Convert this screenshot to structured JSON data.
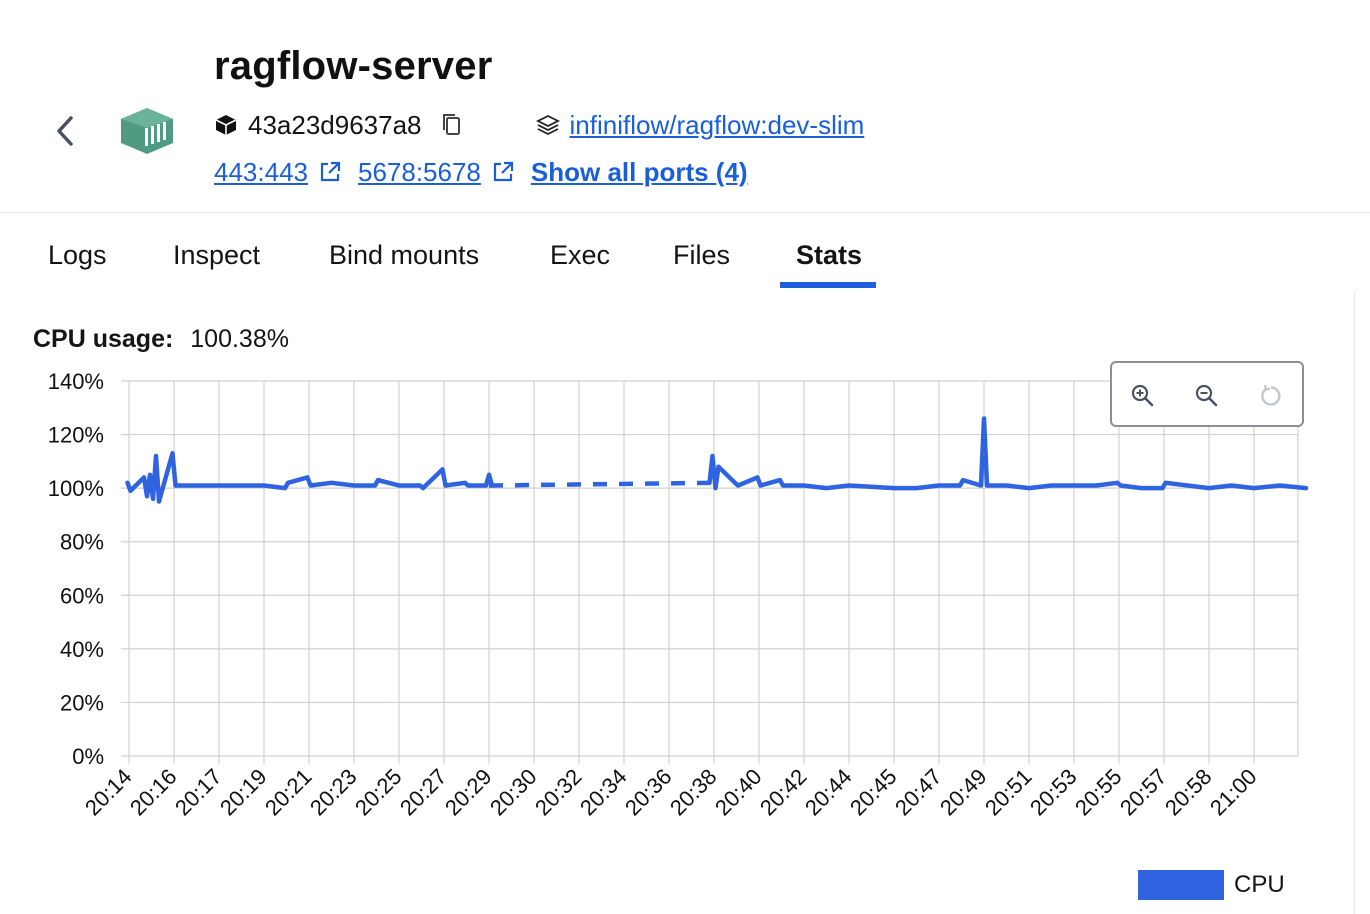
{
  "container": {
    "name": "ragflow-server",
    "id": "43a23d9637a8",
    "image": "infiniflow/ragflow:dev-slim",
    "ports": [
      "443:443",
      "5678:5678"
    ],
    "show_all_ports": "Show all ports (4)"
  },
  "tabs": [
    {
      "label": "Logs"
    },
    {
      "label": "Inspect"
    },
    {
      "label": "Bind mounts"
    },
    {
      "label": "Exec"
    },
    {
      "label": "Files"
    },
    {
      "label": "Stats"
    }
  ],
  "active_tab": "Stats",
  "stats": {
    "cpu_label": "CPU usage:",
    "cpu_value": "100.38%"
  },
  "icons": {
    "back": "chevron-left-icon",
    "container": "container-icon",
    "id": "cube-icon",
    "copy": "copy-icon",
    "image": "image-layers-icon",
    "external": "external-link-icon",
    "zoom_in": "zoom-in-icon",
    "zoom_out": "zoom-out-icon",
    "reset": "reset-icon"
  },
  "colors": {
    "accent": "#1f5fe0",
    "series": "#2f63e0",
    "container_icon": "#4f9a83",
    "link": "#1a5fd8"
  },
  "chart_data": {
    "type": "line",
    "ylim": [
      0,
      140
    ],
    "yticks": [
      "0%",
      "20%",
      "40%",
      "60%",
      "80%",
      "100%",
      "120%",
      "140%"
    ],
    "x_ticks": [
      "20:14",
      "20:16",
      "20:17",
      "20:19",
      "20:21",
      "20:23",
      "20:25",
      "20:27",
      "20:29",
      "20:30",
      "20:32",
      "20:34",
      "20:36",
      "20:38",
      "20:40",
      "20:42",
      "20:44",
      "20:45",
      "20:47",
      "20:49",
      "20:51",
      "20:53",
      "20:55",
      "20:57",
      "20:58",
      "21:00"
    ],
    "grid": true,
    "legend": "bottom-right",
    "series": [
      {
        "name": "CPU",
        "segments": [
          {
            "style": "solid",
            "points": [
              [
                "20:14",
                102
              ],
              [
                "20:14",
                99
              ],
              [
                "20:15",
                104
              ],
              [
                "20:15",
                97
              ],
              [
                "20:15",
                105
              ],
              [
                "20:15",
                96
              ],
              [
                "20:15",
                112
              ],
              [
                "20:15",
                95
              ],
              [
                "20:16",
                113
              ],
              [
                "20:16",
                101
              ],
              [
                "20:17",
                101
              ],
              [
                "20:18",
                101
              ],
              [
                "20:19",
                101
              ],
              [
                "20:20",
                100
              ],
              [
                "20:20",
                102
              ],
              [
                "20:21",
                104
              ],
              [
                "20:21",
                101
              ],
              [
                "20:22",
                102
              ],
              [
                "20:23",
                101
              ],
              [
                "20:24",
                101
              ],
              [
                "20:24",
                103
              ],
              [
                "20:25",
                101
              ],
              [
                "20:26",
                101
              ],
              [
                "20:26",
                100
              ],
              [
                "20:27",
                107
              ],
              [
                "20:27",
                101
              ],
              [
                "20:28",
                102
              ],
              [
                "20:28",
                101
              ],
              [
                "20:29",
                101
              ],
              [
                "20:29",
                105
              ],
              [
                "20:29",
                101
              ]
            ]
          },
          {
            "style": "dashed",
            "points": [
              [
                "20:29",
                101
              ],
              [
                "20:38",
                102
              ]
            ]
          },
          {
            "style": "solid",
            "points": [
              [
                "20:38",
                102
              ],
              [
                "20:38",
                112
              ],
              [
                "20:38",
                100
              ],
              [
                "20:38",
                108
              ],
              [
                "20:39",
                102
              ],
              [
                "20:39",
                101
              ],
              [
                "20:40",
                104
              ],
              [
                "20:40",
                101
              ],
              [
                "20:41",
                103
              ],
              [
                "20:41",
                101
              ],
              [
                "20:42",
                101
              ],
              [
                "20:43",
                100
              ],
              [
                "20:44",
                101
              ],
              [
                "20:45",
                100
              ],
              [
                "20:46",
                100
              ],
              [
                "20:47",
                101
              ],
              [
                "20:48",
                101
              ],
              [
                "20:48",
                103
              ],
              [
                "20:49",
                101
              ],
              [
                "20:49",
                126
              ],
              [
                "20:49",
                101
              ],
              [
                "20:50",
                101
              ],
              [
                "20:51",
                100
              ],
              [
                "20:52",
                101
              ],
              [
                "20:53",
                101
              ],
              [
                "20:54",
                101
              ],
              [
                "20:55",
                102
              ],
              [
                "20:55",
                101
              ],
              [
                "20:56",
                100
              ],
              [
                "20:57",
                100
              ],
              [
                "20:57",
                102
              ],
              [
                "20:58",
                100
              ],
              [
                "20:59",
                101
              ],
              [
                "21:00",
                100
              ],
              [
                "21:01",
                101
              ],
              [
                "21:02",
                100
              ]
            ]
          }
        ]
      }
    ]
  }
}
